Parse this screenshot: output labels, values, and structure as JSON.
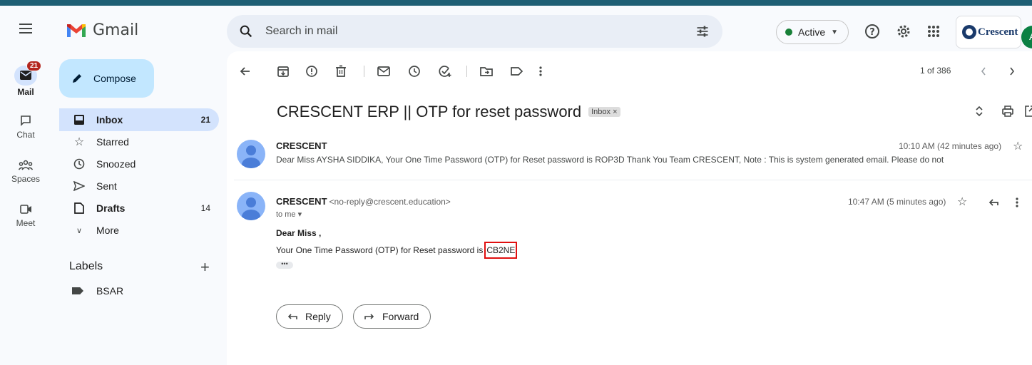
{
  "app": {
    "name": "Gmail",
    "org_name": "Crescent",
    "user_initial": "A"
  },
  "search": {
    "placeholder": "Search in mail"
  },
  "status": {
    "label": "Active",
    "color": "#188038"
  },
  "rail": {
    "items": [
      {
        "label": "Mail",
        "badge": "21"
      },
      {
        "label": "Chat"
      },
      {
        "label": "Spaces"
      },
      {
        "label": "Meet"
      }
    ]
  },
  "nav": {
    "compose": "Compose",
    "items": [
      {
        "label": "Inbox",
        "count": "21"
      },
      {
        "label": "Starred",
        "count": ""
      },
      {
        "label": "Snoozed",
        "count": ""
      },
      {
        "label": "Sent",
        "count": ""
      },
      {
        "label": "Drafts",
        "count": "14"
      },
      {
        "label": "More",
        "count": ""
      }
    ],
    "labels_heading": "Labels",
    "labels": [
      {
        "label": "BSAR"
      }
    ]
  },
  "toolbar": {
    "page_info": "1 of 386"
  },
  "thread": {
    "subject": "CRESCENT ERP || OTP for reset password",
    "chip": "Inbox ×",
    "messages": [
      {
        "sender": "CRESCENT",
        "time": "10:10 AM (42 minutes ago)",
        "snippet": "Dear Miss AYSHA SIDDIKA, Your One Time Password (OTP) for Reset password is ROP3D Thank You Team CRESCENT, Note : This is system generated email. Please do not"
      },
      {
        "sender": "CRESCENT",
        "email": "<no-reply@crescent.education>",
        "time": "10:47 AM (5 minutes ago)",
        "to": "to me ▾",
        "greeting": "Dear Miss ,",
        "body": "Your One Time Password (OTP) for Reset password is ",
        "otp": "CB2NE",
        "ellipsis": "•••"
      }
    ],
    "reply": "Reply",
    "forward": "Forward"
  }
}
